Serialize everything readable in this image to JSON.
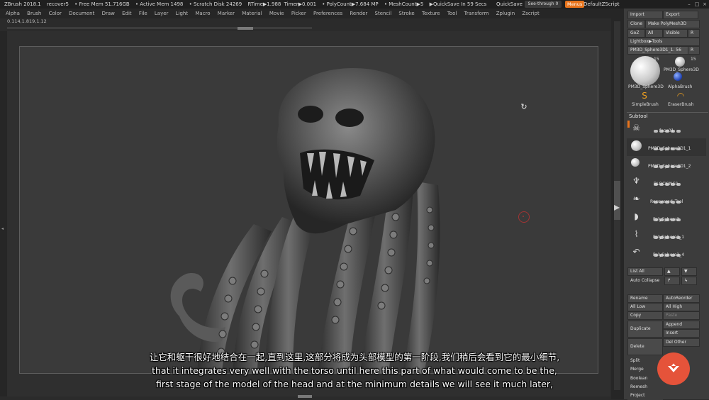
{
  "title_bar": {
    "app": "ZBrush 2018.1",
    "document": "recover5",
    "free_mem": "• Free Mem 51.716GB",
    "active_mem": "• Active Mem 1498",
    "scratch_disk": "• Scratch Disk 24269",
    "rtime": "RTime▶1.988",
    "timer": "Timer▶0.001",
    "polycount": "• PolyCount▶7.684 MP",
    "meshcount": "• MeshCount▶5",
    "quicksave_timer": "▶QuickSave In 59 Secs",
    "quicksave": "QuickSave",
    "see_through": "See-through",
    "see_through_value": "0",
    "menus": "Menus",
    "default_script": "DefaultZScript"
  },
  "menu": [
    "Alpha",
    "Brush",
    "Color",
    "Document",
    "Draw",
    "Edit",
    "File",
    "Layer",
    "Light",
    "Macro",
    "Marker",
    "Material",
    "Movie",
    "Picker",
    "Preferences",
    "Render",
    "Stencil",
    "Stroke",
    "Texture",
    "Tool",
    "Transform",
    "Zplugin",
    "Zscript"
  ],
  "coords": "0.114,1.819,1.12",
  "tool_panel": {
    "import": "Import",
    "export": "Export",
    "clone": "Clone",
    "make_polymesh": "Make PolyMesh3D",
    "goz": "GoZ",
    "all": "All",
    "visible": "Visible",
    "r": "R",
    "lightbox": "Lightbox▶Tools",
    "current_tool": "PM3D_Sphere3D1_1.",
    "current_count": "56",
    "current_r": "R",
    "count_a": "15",
    "count_b": "15",
    "thumb_big_label": "PM3D_Sphere3D",
    "thumb_small_label": "PM3D_Sphere3D",
    "alpha_brush": "AlphaBrush",
    "simple_brush": "SimpleBrush",
    "eraser_brush": "EraserBrush"
  },
  "subtool": {
    "header": "Subtool",
    "items": [
      {
        "name": "face01",
        "icon": "skull-icon"
      },
      {
        "name": "PM3D_Sphere3D1_1",
        "icon": "sphere-icon"
      },
      {
        "name": "PM3D_Sphere3D1_2",
        "icon": "sphere-icon"
      },
      {
        "name": "BLOCKING1",
        "icon": "tentacles-icon"
      },
      {
        "name": "Recovered_Tool",
        "icon": "tentacle-icon"
      },
      {
        "name": "PolySphere2",
        "icon": "blob-icon"
      },
      {
        "name": "PolySphere1_1",
        "icon": "curve-icon"
      },
      {
        "name": "PolySphere1_4",
        "icon": "hook-icon"
      }
    ],
    "list_all": "List All",
    "auto_collapse": "Auto Collapse",
    "rename": "Rename",
    "auto_reorder": "AutoReorder",
    "all_low": "All Low",
    "all_high": "All High",
    "copy": "Copy",
    "paste": "Paste",
    "duplicate": "Duplicate",
    "append": "Append",
    "insert": "Insert",
    "delete": "Delete",
    "del_other": "Del Other",
    "split": "Split",
    "merge": "Merge",
    "boolean": "Boolean",
    "remesh": "Remesh",
    "project": "Project"
  },
  "subtitles": {
    "chinese": "让它和躯干很好地结合在一起,直到这里,这部分将成为头部模型的第一阶段,我们稍后会看到它的最小细节,",
    "english_1": "that it integrates very well with the torso until here this part of what would come to be the,",
    "english_2": "first stage of the model of the head and at the minimum details we will see it much later,"
  },
  "colors": {
    "accent": "#e8741c",
    "logo": "#e5533a",
    "brush_cursor": "#a23434"
  }
}
